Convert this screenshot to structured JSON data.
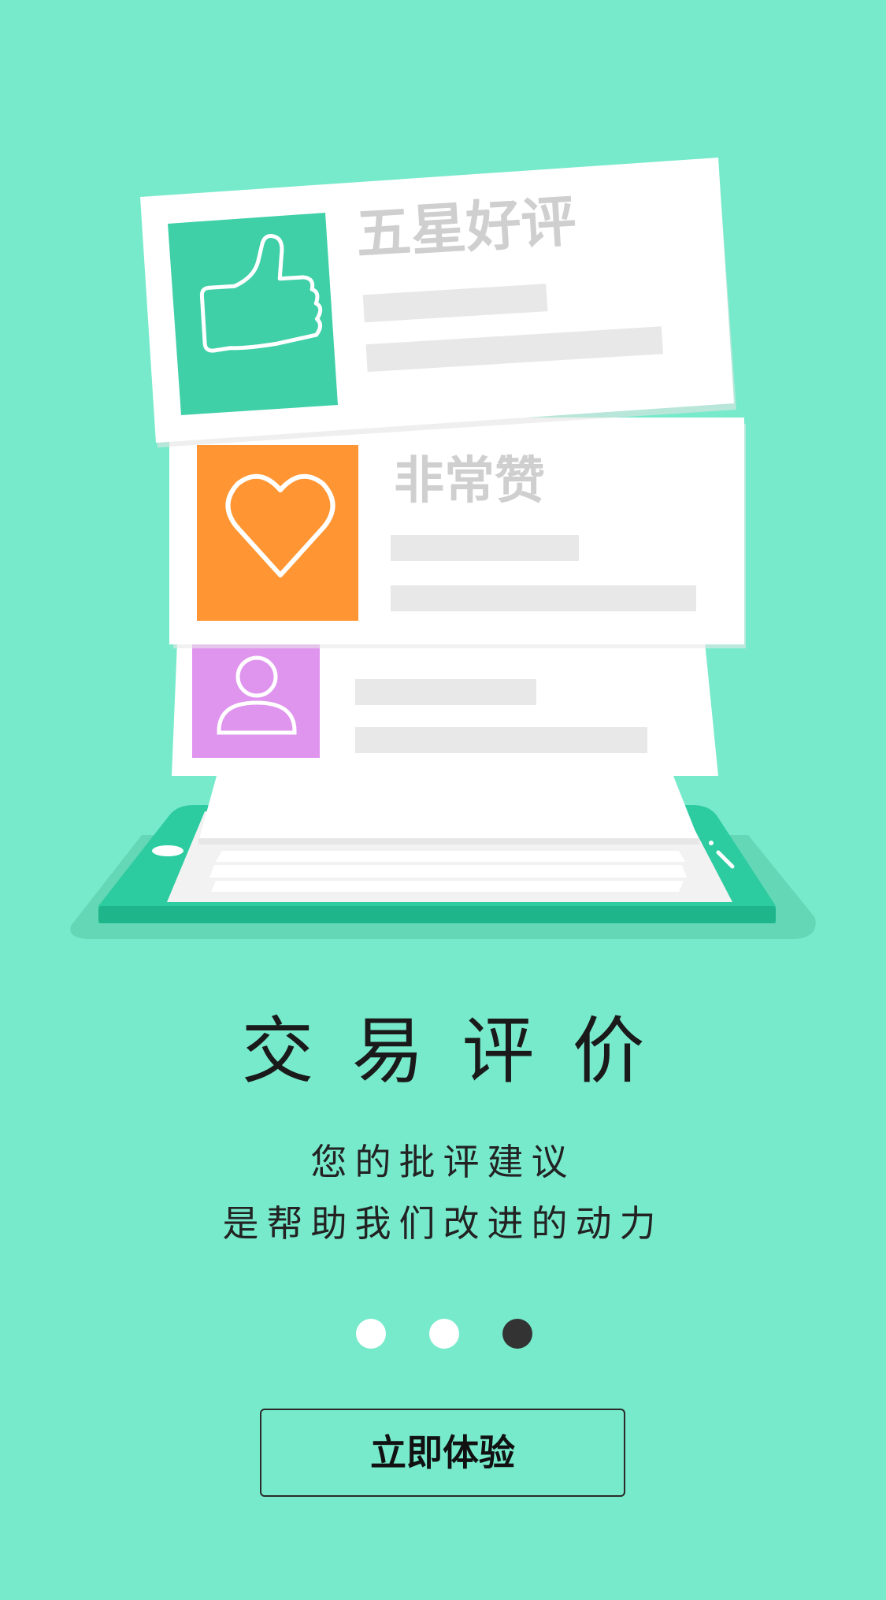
{
  "colors": {
    "background": "#77eacb",
    "phone": "#2ccca0",
    "like_tile": "#3fd0a8",
    "heart_tile": "#ff9633",
    "user_tile": "#df94ee",
    "inactive_dot": "#ffffff",
    "active_dot": "#333333"
  },
  "cards": [
    {
      "icon": "thumbs-up-icon",
      "title": "五星好评"
    },
    {
      "icon": "heart-icon",
      "title": "非常赞"
    },
    {
      "icon": "user-icon",
      "title": ""
    }
  ],
  "title": "交易评价",
  "subtitle_line1": "您的批评建议",
  "subtitle_line2": "是帮助我们改进的动力",
  "pagination": {
    "total": 3,
    "active": 3
  },
  "cta_label": "立即体验"
}
